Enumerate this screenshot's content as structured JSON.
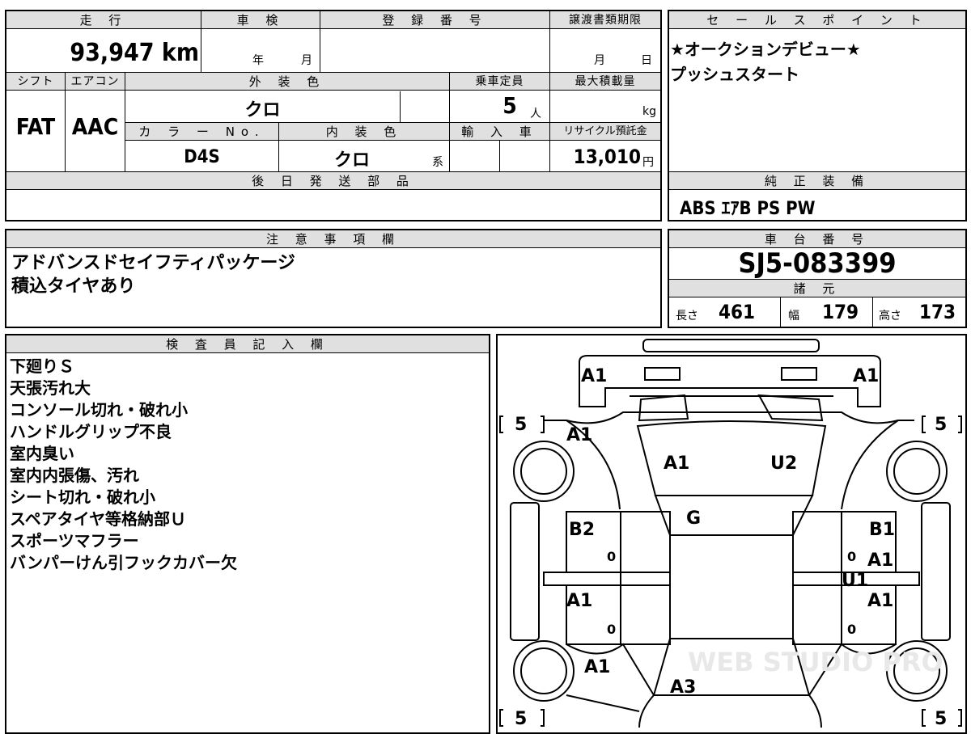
{
  "main": {
    "mileage": {
      "label": "走 行",
      "value": "93,947",
      "unit": "km"
    },
    "inspection": {
      "label": "車 検",
      "year": "年",
      "month": "月"
    },
    "registration": {
      "label": "登 録 番 号"
    },
    "transfer_deadline": {
      "label": "譲渡書類期限",
      "month": "月",
      "day": "日"
    },
    "shift": {
      "label": "シフト",
      "value": "FAT"
    },
    "aircon": {
      "label": "エアコン",
      "value": "AAC"
    },
    "exterior_color": {
      "label": "外 装 色",
      "value": "クロ"
    },
    "capacity": {
      "label": "乗車定員",
      "value": "5",
      "unit": "人"
    },
    "max_load": {
      "label": "最大積載量",
      "unit": "kg"
    },
    "color_no": {
      "label": "カ ラ ー No.",
      "value": "D4S"
    },
    "interior_color": {
      "label": "内 装 色",
      "value": "クロ",
      "suffix": "系"
    },
    "import": {
      "label": "輸 入 車"
    },
    "recycle": {
      "label": "リサイクル預託金",
      "value": "13,010",
      "unit": "円"
    },
    "later_parts": {
      "label": "後 日 発 送 部 品",
      "value": ""
    }
  },
  "sales_points": {
    "label": "セ ー ル ス ポ イ ン ト",
    "lines": [
      "★オークションデビュー★",
      "プッシュスタート"
    ]
  },
  "equipment": {
    "label": "純 正 装 備",
    "value": "ABS ｴｱB PS PW"
  },
  "notes": {
    "label": "注 意 事 項 欄",
    "lines": [
      "アドバンスドセイフティパッケージ",
      "積込タイヤあり"
    ]
  },
  "chassis": {
    "label": "車 台 番 号",
    "value": "SJ5-083399"
  },
  "specs": {
    "label": "諸 元",
    "length": {
      "label": "長さ",
      "value": "461"
    },
    "width": {
      "label": "幅",
      "value": "179"
    },
    "height": {
      "label": "高さ",
      "value": "173"
    }
  },
  "inspector": {
    "label": "検 査 員 記 入 欄",
    "lines": [
      "下廻りＳ",
      "天張汚れ大",
      "コンソール切れ・破れ小",
      "ハンドルグリップ不良",
      "室内臭い",
      "室内内張傷、汚れ",
      "シート切れ・破れ小",
      "スペアタイヤ等格納部Ｕ",
      "スポーツマフラー",
      "バンパーけん引フックカバー欠"
    ]
  },
  "diagram": {
    "marks": {
      "front_left": "A1",
      "front_right": "A1",
      "left_fender": "A1",
      "hood_left": "A1",
      "hood_right": "U2",
      "windshield": "G",
      "left_front_door": "B2",
      "right_front_door": "B1",
      "right_front_door_2": "A1",
      "right_sill": "U1",
      "left_rear_door": "A1",
      "right_rear_door": "A1",
      "left_quarter": "A1",
      "rear_gate": "A3"
    },
    "tires": {
      "fl": "5",
      "fr": "5",
      "rl": "5",
      "rr": "5"
    },
    "zeros": [
      "0",
      "0",
      "0",
      "0"
    ],
    "watermark": "WEB STUDIO PRO"
  }
}
